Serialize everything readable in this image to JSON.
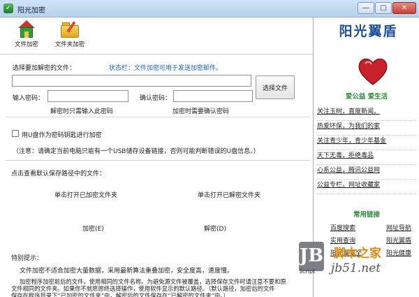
{
  "window": {
    "title": "阳光加密",
    "min_glyph": "—",
    "max_glyph": "□",
    "close_glyph": "✕",
    "app_glyph": "✓"
  },
  "toolbar": {
    "file_encrypt": "文件加密",
    "folder_encrypt": "文件夹加密"
  },
  "brand": "阳光翼盾",
  "form": {
    "select_label": "选择要加解密的文件：",
    "status_prefix": "状态栏：",
    "status_text": "文件加密可用于发送加密邮件。",
    "file_path_value": "",
    "select_file_button": "选择文件",
    "password_label": "输入密码：",
    "password_value": "",
    "password_hint": "解密时只需输入此密码",
    "confirm_label": "确认密码：",
    "confirm_value": "",
    "confirm_hint": "加密时需要确认密码",
    "usb_label": "用U盘作为密码钥匙进行加密",
    "usb_note": "（注意：请确定当前电脑只能有一个USB储存设备链接，否则可能判断错误的U盘信息。）",
    "default_path_label": "点击查看默认保存路径中的文件：",
    "open_encrypted_folder": "单击打开已加密文件夹",
    "open_decrypted_folder": "单击打开已解密文件夹",
    "encrypt_button": "加密(E)",
    "decrypt_button": "解密(D)"
  },
  "tips": {
    "title": "特别提示：",
    "line1": "文件加密不适合加密大量数据，采用最新算法重叠加密，安全度高，速度慢。",
    "line2": "加密程序加密前后的文件，使用相同的文件名称。为避免源文件被覆盖，选择保存文件时请注意不要和原",
    "line3": "文件相同的文件夹。如果你不就愿愿终选择操作，使用软件显示的默认路径。（默认路径，加密后的文件",
    "line4": "保存在程序目录下“已加密的文件夹”中，解密后的文件保存在“已解密的文件夹”中。）"
  },
  "sidebar": {
    "slogan": "爱公益 爱生活",
    "links": [
      "关注玉树，直度新闻。",
      "热爱环保，为我们的家",
      "关注青少年，青少年基金",
      "天下无毒，拒绝毒品",
      "心系公益，腾讯公益网",
      "公益专栏，网址收藏家"
    ],
    "common_title": "常用链接",
    "common_links": [
      "百度搜索",
      "网址导航",
      "实用查询",
      "阳光翼盾",
      "阳光翼安全",
      "阳光健康"
    ]
  },
  "watermark": {
    "logo": "JB",
    "script": "Script",
    "cn": "脚本之家",
    "url": "jb51.net"
  }
}
